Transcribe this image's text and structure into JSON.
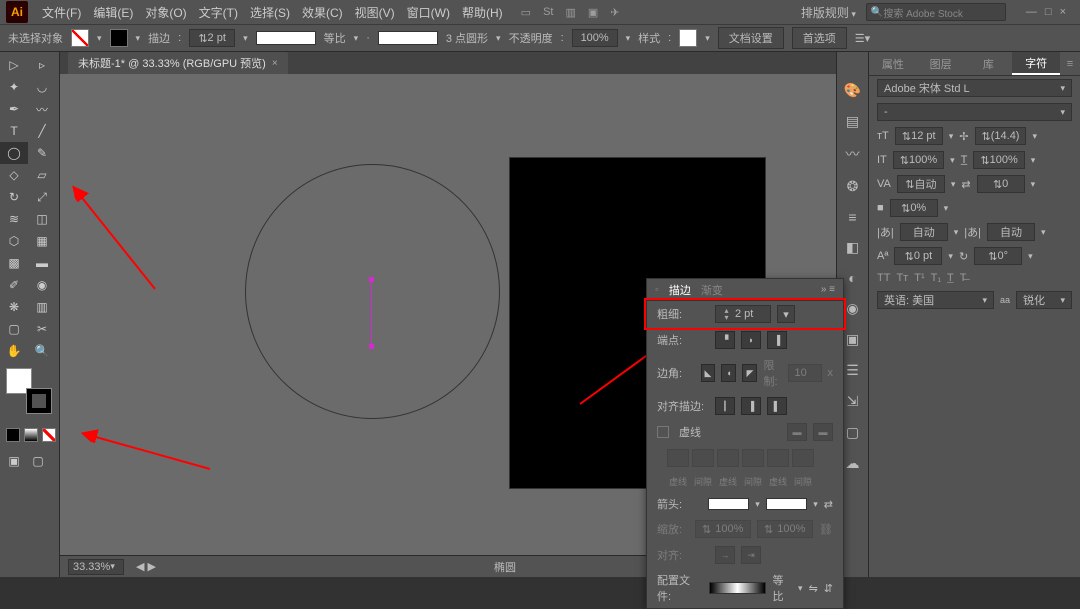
{
  "app": {
    "logo": "Ai"
  },
  "menu": [
    "文件(F)",
    "编辑(E)",
    "对象(O)",
    "文字(T)",
    "选择(S)",
    "效果(C)",
    "视图(V)",
    "窗口(W)",
    "帮助(H)"
  ],
  "layout_preset": "排版规则",
  "search_placeholder": "搜索 Adobe Stock",
  "window_buttons": {
    "min": "—",
    "max": "□",
    "close": "×"
  },
  "ctrl": {
    "no_selection": "未选择对象",
    "stroke_label": "描边",
    "stroke_pt": "2 pt",
    "stroke_profile": "等比",
    "brush_label": "3 点圆形",
    "opacity_label": "不透明度",
    "opacity_val": "100%",
    "style_label": "样式",
    "doc_setup": "文档设置",
    "prefs": "首选项"
  },
  "doc_tab": "未标题-1* @ 33.33% (RGB/GPU 预览)",
  "status": {
    "zoom": "33.33%",
    "nav": "◀  ▶",
    "tool": "椭圆"
  },
  "char_panel": {
    "tabs": [
      "属性",
      "图层",
      "库",
      "字符"
    ],
    "font": "Adobe 宋体 Std L",
    "style": "-",
    "size": "12 pt",
    "leading": "(14.4)",
    "vscale": "100%",
    "hscale": "100%",
    "kerning": "自动",
    "tracking": "0",
    "baseline": "0%",
    "tsume": "自动",
    "shift": "0 pt",
    "rotate": "0°",
    "lang": "英语: 美国",
    "aa": "锐化"
  },
  "stroke_panel": {
    "tab1": "描边",
    "tab2": "渐变",
    "weight_label": "粗细:",
    "weight_val": "2 pt",
    "cap_label": "端点:",
    "corner_label": "边角:",
    "limit_label": "限制:",
    "limit_val": "10",
    "limit_x": "x",
    "align_label": "对齐描边:",
    "dash_label": "虚线",
    "dash_cols": [
      "虚线",
      "间隙",
      "虚线",
      "间隙",
      "虚线",
      "间隙"
    ],
    "arrow_label": "箭头:",
    "scale_label": "缩放:",
    "scale_val": "100%",
    "alignarrow_label": "对齐:",
    "profile_label": "配置文件:",
    "profile_val": "等比"
  }
}
